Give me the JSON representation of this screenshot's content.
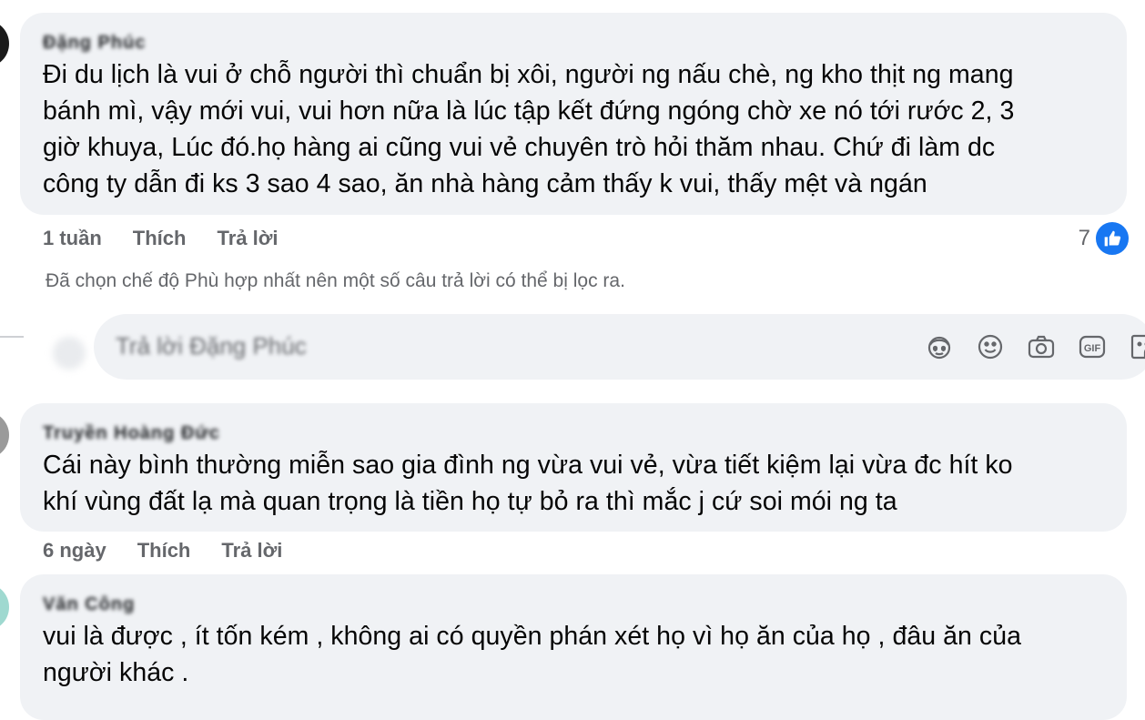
{
  "comments": [
    {
      "author": "Đặng Phúc",
      "text_lines": [
        "Đi du lịch là vui ở chỗ người thì chuẩn bị xôi, người ng nấu chè, ng kho thịt ng mang",
        "bánh mì, vậy mới vui, vui hơn nữa là lúc tập kết đứng ngóng chờ xe nó tới rước 2, 3",
        "giờ khuya, Lúc đó.họ hàng ai cũng vui vẻ chuyên trò hỏi thăm nhau. Chứ đi làm dc",
        "công ty dẫn đi ks 3 sao 4 sao, ăn nhà hàng cảm thấy k vui, thấy mệt và ngán"
      ],
      "time": "1 tuần",
      "like_label": "Thích",
      "reply_label": "Trả lời",
      "reaction_count": "7",
      "reaction_icon": "like-icon"
    },
    {
      "author": "Truyền Hoàng Đức",
      "text_lines": [
        "Cái này bình thường miễn sao gia đình ng vừa vui vẻ, vừa tiết kiệm lại vừa đc hít ko",
        "khí vùng đất lạ mà quan trọng là tiền họ tự bỏ ra thì mắc j cứ soi mói ng ta"
      ],
      "time": "6 ngày",
      "like_label": "Thích",
      "reply_label": "Trả lời"
    },
    {
      "author": "Văn Công",
      "text_lines": [
        "vui là được , ít tốn kém , không ai có quyền phán xét họ vì họ ăn của họ , đâu ăn của",
        "người khác ."
      ]
    }
  ],
  "filter_note": "Đã chọn chế độ Phù hợp nhất nên một số câu trả lời có thể bị lọc ra.",
  "reply_box": {
    "placeholder": "Trả lời Đặng Phúc",
    "icons": [
      "avatar-sticker-icon",
      "emoji-icon",
      "camera-icon",
      "gif-icon",
      "sticker-icon"
    ]
  },
  "colors": {
    "bubble": "#f0f2f5",
    "muted_text": "#65676b",
    "like_blue": "#1877f2"
  }
}
